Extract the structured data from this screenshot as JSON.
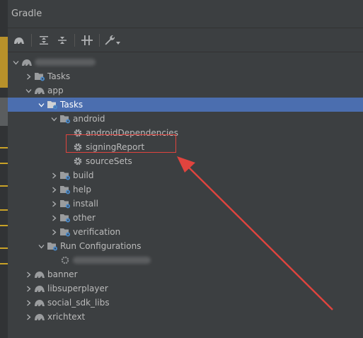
{
  "panel": {
    "title": "Gradle"
  },
  "toolbar": {
    "buttons": [
      {
        "name": "refresh-gradle-icon"
      },
      {
        "name": "expand-all-icon"
      },
      {
        "name": "collapse-all-icon"
      },
      {
        "name": "toggle-offline-icon"
      },
      {
        "name": "build-settings-icon"
      }
    ]
  },
  "tree": {
    "root": {
      "label": ""
    },
    "root_tasks": {
      "label": "Tasks"
    },
    "app": {
      "label": "app"
    },
    "app_tasks": {
      "label": "Tasks"
    },
    "android": {
      "label": "android"
    },
    "android_dependencies": {
      "label": "androidDependencies"
    },
    "signing_report": {
      "label": "signingReport"
    },
    "source_sets": {
      "label": "sourceSets"
    },
    "build": {
      "label": "build"
    },
    "help": {
      "label": "help"
    },
    "install": {
      "label": "install"
    },
    "other": {
      "label": "other"
    },
    "verification": {
      "label": "verification"
    },
    "run_configurations": {
      "label": "Run Configurations"
    },
    "run_config_item": {
      "label": ""
    },
    "banner": {
      "label": "banner"
    },
    "libsuperplayer": {
      "label": "libsuperplayer"
    },
    "social_sdk_libs": {
      "label": "social_sdk_libs"
    },
    "xrichtext": {
      "label": "xrichtext"
    }
  },
  "colors": {
    "background": "#3c3f41",
    "selection": "#4b6eaf",
    "annotation": "#e0443e"
  }
}
